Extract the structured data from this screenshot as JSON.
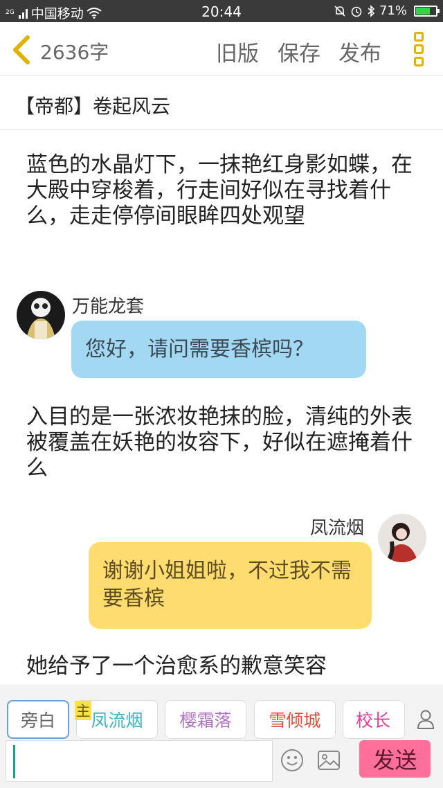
{
  "status_bar": {
    "sim": "2G",
    "carrier": "中国移动",
    "time": "20:44",
    "battery_percent": "71%",
    "battery_level": 0.71
  },
  "toolbar": {
    "word_count": "2636字",
    "old_version": "旧版",
    "save": "保存",
    "publish": "发布",
    "accent_color": "#e0b400"
  },
  "title": "【帝都】卷起风云",
  "story": {
    "narration_1": "蓝色的水晶灯下，一抹艳红身影如蝶，在大殿中穿梭着，行走间好似在寻找着什么，走走停停间眼眸四处观望",
    "message_1": {
      "speaker": "万能龙套",
      "text": "您好，请问需要香槟吗？",
      "color": "#a3d8f3"
    },
    "narration_2": "入目的是一张浓妆艳抹的脸，清纯的外表被覆盖在妖艳的妆容下，好似在遮掩着什么",
    "message_2": {
      "speaker": "凤流烟",
      "text": "谢谢小姐姐啦，不过我不需要香槟",
      "color": "#ffdc70"
    },
    "narration_3": "她给予了一个治愈系的歉意笑容"
  },
  "roles": {
    "narrator": "旁白",
    "host_badge": "主",
    "items": [
      "凤流烟",
      "樱霜落",
      "雪倾城",
      "校长"
    ]
  },
  "composer": {
    "input_value": "",
    "send": "发送",
    "send_color": "#ff6f9c"
  }
}
